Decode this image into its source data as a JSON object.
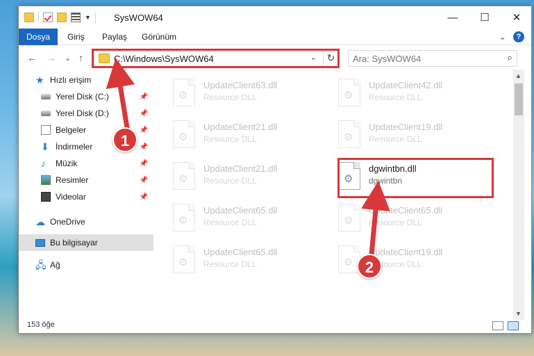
{
  "window": {
    "title": "SysWOW64",
    "controls": {
      "minimize": "—",
      "maximize": "☐",
      "close": "✕"
    }
  },
  "ribbon": {
    "tabs": [
      "Dosya",
      "Giriş",
      "Paylaş",
      "Görünüm"
    ],
    "collapse_icon": "⌄",
    "help_icon": "?"
  },
  "nav": {
    "back": "←",
    "forward": "→",
    "recent": "⌄",
    "up": "↑",
    "address": "C:\\Windows\\SysWOW64",
    "address_drop": "⌄",
    "refresh": "↻",
    "search_placeholder": "Ara: SysWOW64",
    "search_icon": "⌕"
  },
  "sidebar": {
    "items": [
      {
        "label": "Hızlı erişim",
        "icon": "star-icon"
      },
      {
        "label": "Yerel Disk (C:)",
        "icon": "drive-icon",
        "pinned": true
      },
      {
        "label": "Yerel Disk (D:)",
        "icon": "drive-icon",
        "pinned": true
      },
      {
        "label": "Belgeler",
        "icon": "document-icon",
        "pinned": true
      },
      {
        "label": "İndirmeler",
        "icon": "download-icon",
        "pinned": true
      },
      {
        "label": "Müzik",
        "icon": "music-icon",
        "pinned": true
      },
      {
        "label": "Resimler",
        "icon": "pictures-icon",
        "pinned": true
      },
      {
        "label": "Videolar",
        "icon": "video-icon",
        "pinned": true
      },
      {
        "label": "OneDrive",
        "icon": "cloud-icon"
      },
      {
        "label": "Bu bilgisayar",
        "icon": "computer-icon",
        "selected": true
      },
      {
        "label": "Ağ",
        "icon": "network-icon"
      }
    ],
    "pin_glyph": "📌"
  },
  "files": [
    {
      "name": "UpdateClient63.dll",
      "type": "Resource DLL"
    },
    {
      "name": "UpdateClient42.dll",
      "type": "Resource DLL"
    },
    {
      "name": "UpdateClient21.dll",
      "type": "Resource DLL"
    },
    {
      "name": "UpdateClient19.dll",
      "type": "Resource DLL"
    },
    {
      "name": "UpdateClient21.dll",
      "type": "Resource DLL"
    },
    {
      "name": "dgwintbn.dll",
      "type": "dgwintbn"
    },
    {
      "name": "UpdateClient65.dll",
      "type": "Resource DLL"
    },
    {
      "name": "UpdateClient65.dll",
      "type": "Resource DLL"
    },
    {
      "name": "UpdateClient65.dll",
      "type": "Resource DLL"
    },
    {
      "name": "UpdateClient19.dll",
      "type": "Resource DLL"
    }
  ],
  "status": {
    "item_count": "153 öğe"
  },
  "annotations": {
    "step1": "1",
    "step2": "2"
  },
  "colors": {
    "accent": "#1a66c0",
    "highlight": "#d9383a"
  }
}
